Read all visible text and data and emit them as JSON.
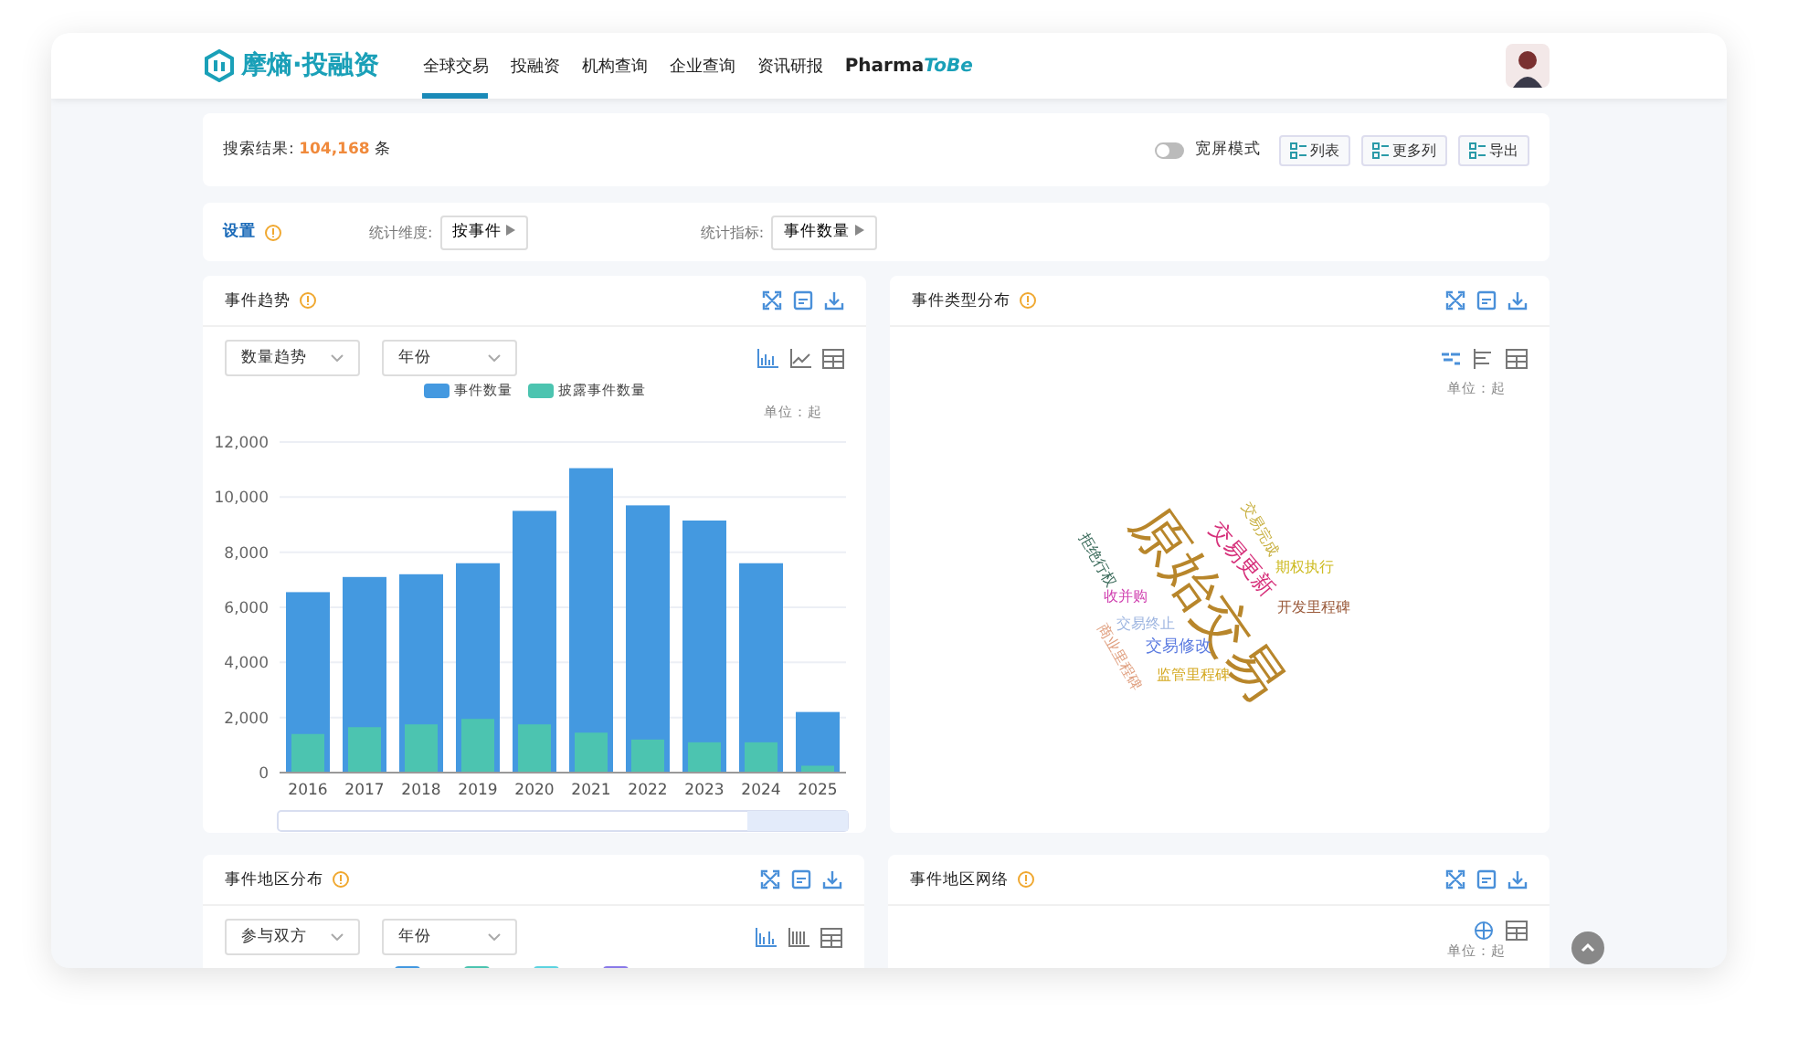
{
  "brand": {
    "name": "摩熵·投融资"
  },
  "nav": [
    {
      "label": "全球交易",
      "selected": true
    },
    {
      "label": "投融资",
      "selected": false
    },
    {
      "label": "机构查询",
      "selected": false
    },
    {
      "label": "企业查询",
      "selected": false
    },
    {
      "label": "资讯研报",
      "selected": false
    }
  ],
  "nav_brand": {
    "main": "Pharma",
    "accent": "ToBe"
  },
  "results": {
    "label": "搜索结果:",
    "count": "104,168",
    "unit": "条",
    "wide_mode": {
      "label": "宽屏模式",
      "on": false
    },
    "buttons": [
      "列表",
      "更多列",
      "导出"
    ]
  },
  "settings": {
    "title": "设置",
    "dimension_label": "统计维度:",
    "dimension": "按事件",
    "metric_label": "统计指标:",
    "metric": "事件数量"
  },
  "trend": {
    "title": "事件趋势",
    "selects": [
      "数量趋势",
      "年份"
    ],
    "unit": "单位：起",
    "chart_data": {
      "type": "bar",
      "categories": [
        "2016",
        "2017",
        "2018",
        "2019",
        "2020",
        "2021",
        "2022",
        "2023",
        "2024",
        "2025"
      ],
      "series": [
        {
          "name": "事件数量",
          "color": "#4499e0",
          "values": [
            6550,
            7100,
            7200,
            7600,
            9500,
            11050,
            9700,
            9150,
            7600,
            2200
          ]
        },
        {
          "name": "披露事件数量",
          "color": "#4cc4b0",
          "values": [
            1400,
            1650,
            1750,
            1950,
            1750,
            1450,
            1200,
            1100,
            1100,
            250
          ]
        }
      ],
      "grid": true,
      "ylim": [
        0,
        12000
      ],
      "yticks": [
        {
          "value": 0,
          "label": "0"
        },
        {
          "value": 2000,
          "label": "2,000"
        },
        {
          "value": 4000,
          "label": "4,000"
        },
        {
          "value": 6000,
          "label": "6,000"
        },
        {
          "value": 8000,
          "label": "8,000"
        },
        {
          "value": 10000,
          "label": "10,000"
        },
        {
          "value": 12000,
          "label": "12,000"
        }
      ]
    }
  },
  "types": {
    "title": "事件类型分布",
    "unit": "单位：起",
    "words": [
      {
        "text": "原始交易",
        "color": "#b8862b"
      },
      {
        "text": "交易更新",
        "color": "#d6307a"
      },
      {
        "text": "交易完成",
        "color": "#c8b040"
      },
      {
        "text": "期权执行",
        "color": "#cdbb22"
      },
      {
        "text": "开发里程碑",
        "color": "#9a5a3a"
      },
      {
        "text": "拒绝行权",
        "color": "#3a6a5a"
      },
      {
        "text": "收并购",
        "color": "#d040b0"
      },
      {
        "text": "交易终止",
        "color": "#9db5e0"
      },
      {
        "text": "交易修改",
        "color": "#5a7ae0"
      },
      {
        "text": "商业里程碑",
        "color": "#e0a080"
      },
      {
        "text": "监管里程碑",
        "color": "#d4a820"
      }
    ]
  },
  "region": {
    "title": "事件地区分布",
    "selects": [
      "参与双方",
      "年份"
    ],
    "legend": [
      {
        "color": "#4499e0"
      },
      {
        "color": "#4cc4b0"
      },
      {
        "color": "#5dd4e0"
      },
      {
        "color": "#8a7ae8"
      }
    ]
  },
  "network": {
    "title": "事件地区网络",
    "unit": "单位：起"
  }
}
